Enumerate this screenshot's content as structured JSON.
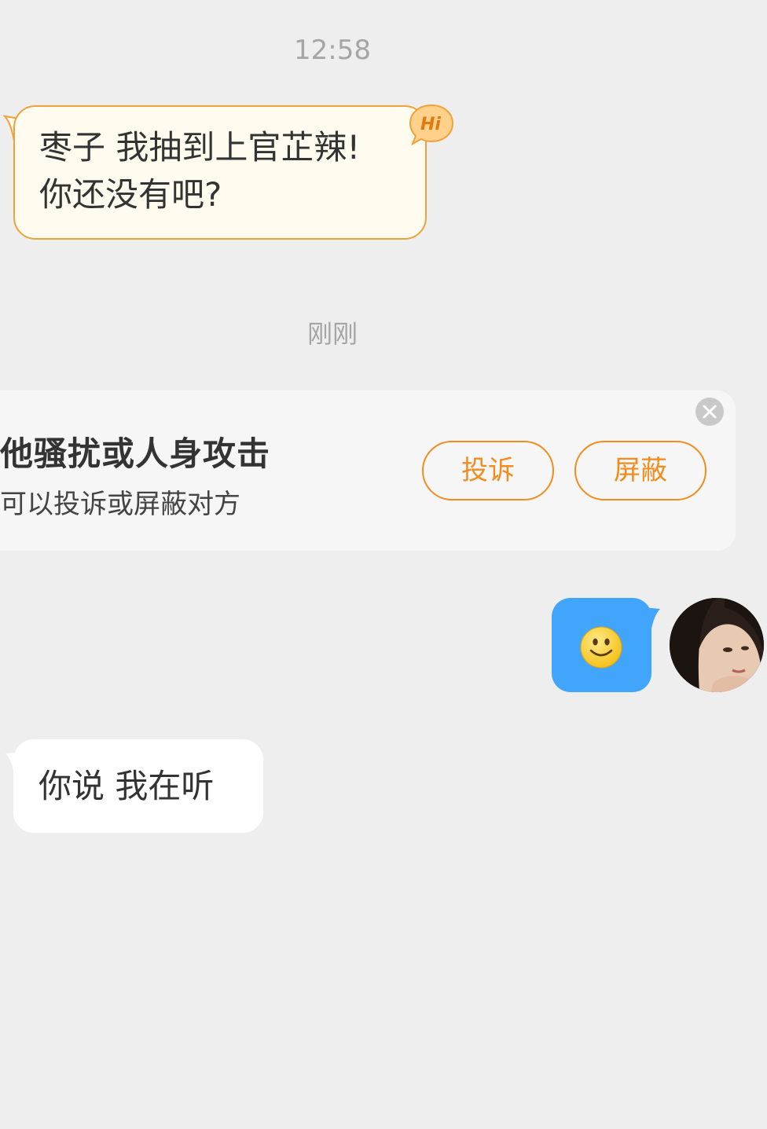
{
  "chat": {
    "time_first": "12:58",
    "time_second": "刚刚",
    "greeting_message": "枣子 我抽到上官芷辣!\n你还没有吧?",
    "greeting_badge": "Hi",
    "incoming_message": "你说 我在听"
  },
  "warning": {
    "title": "他骚扰或人身攻击",
    "subtitle": "可以投诉或屏蔽对方",
    "report_label": "投诉",
    "block_label": "屏蔽"
  },
  "outgoing": {
    "emoji": "smile-emoji"
  },
  "colors": {
    "accent_orange": "#f28c1e",
    "outgoing_bubble": "#41a5fb",
    "greeting_bubble_fill": "#fffcef",
    "background": "#eeeeee"
  }
}
